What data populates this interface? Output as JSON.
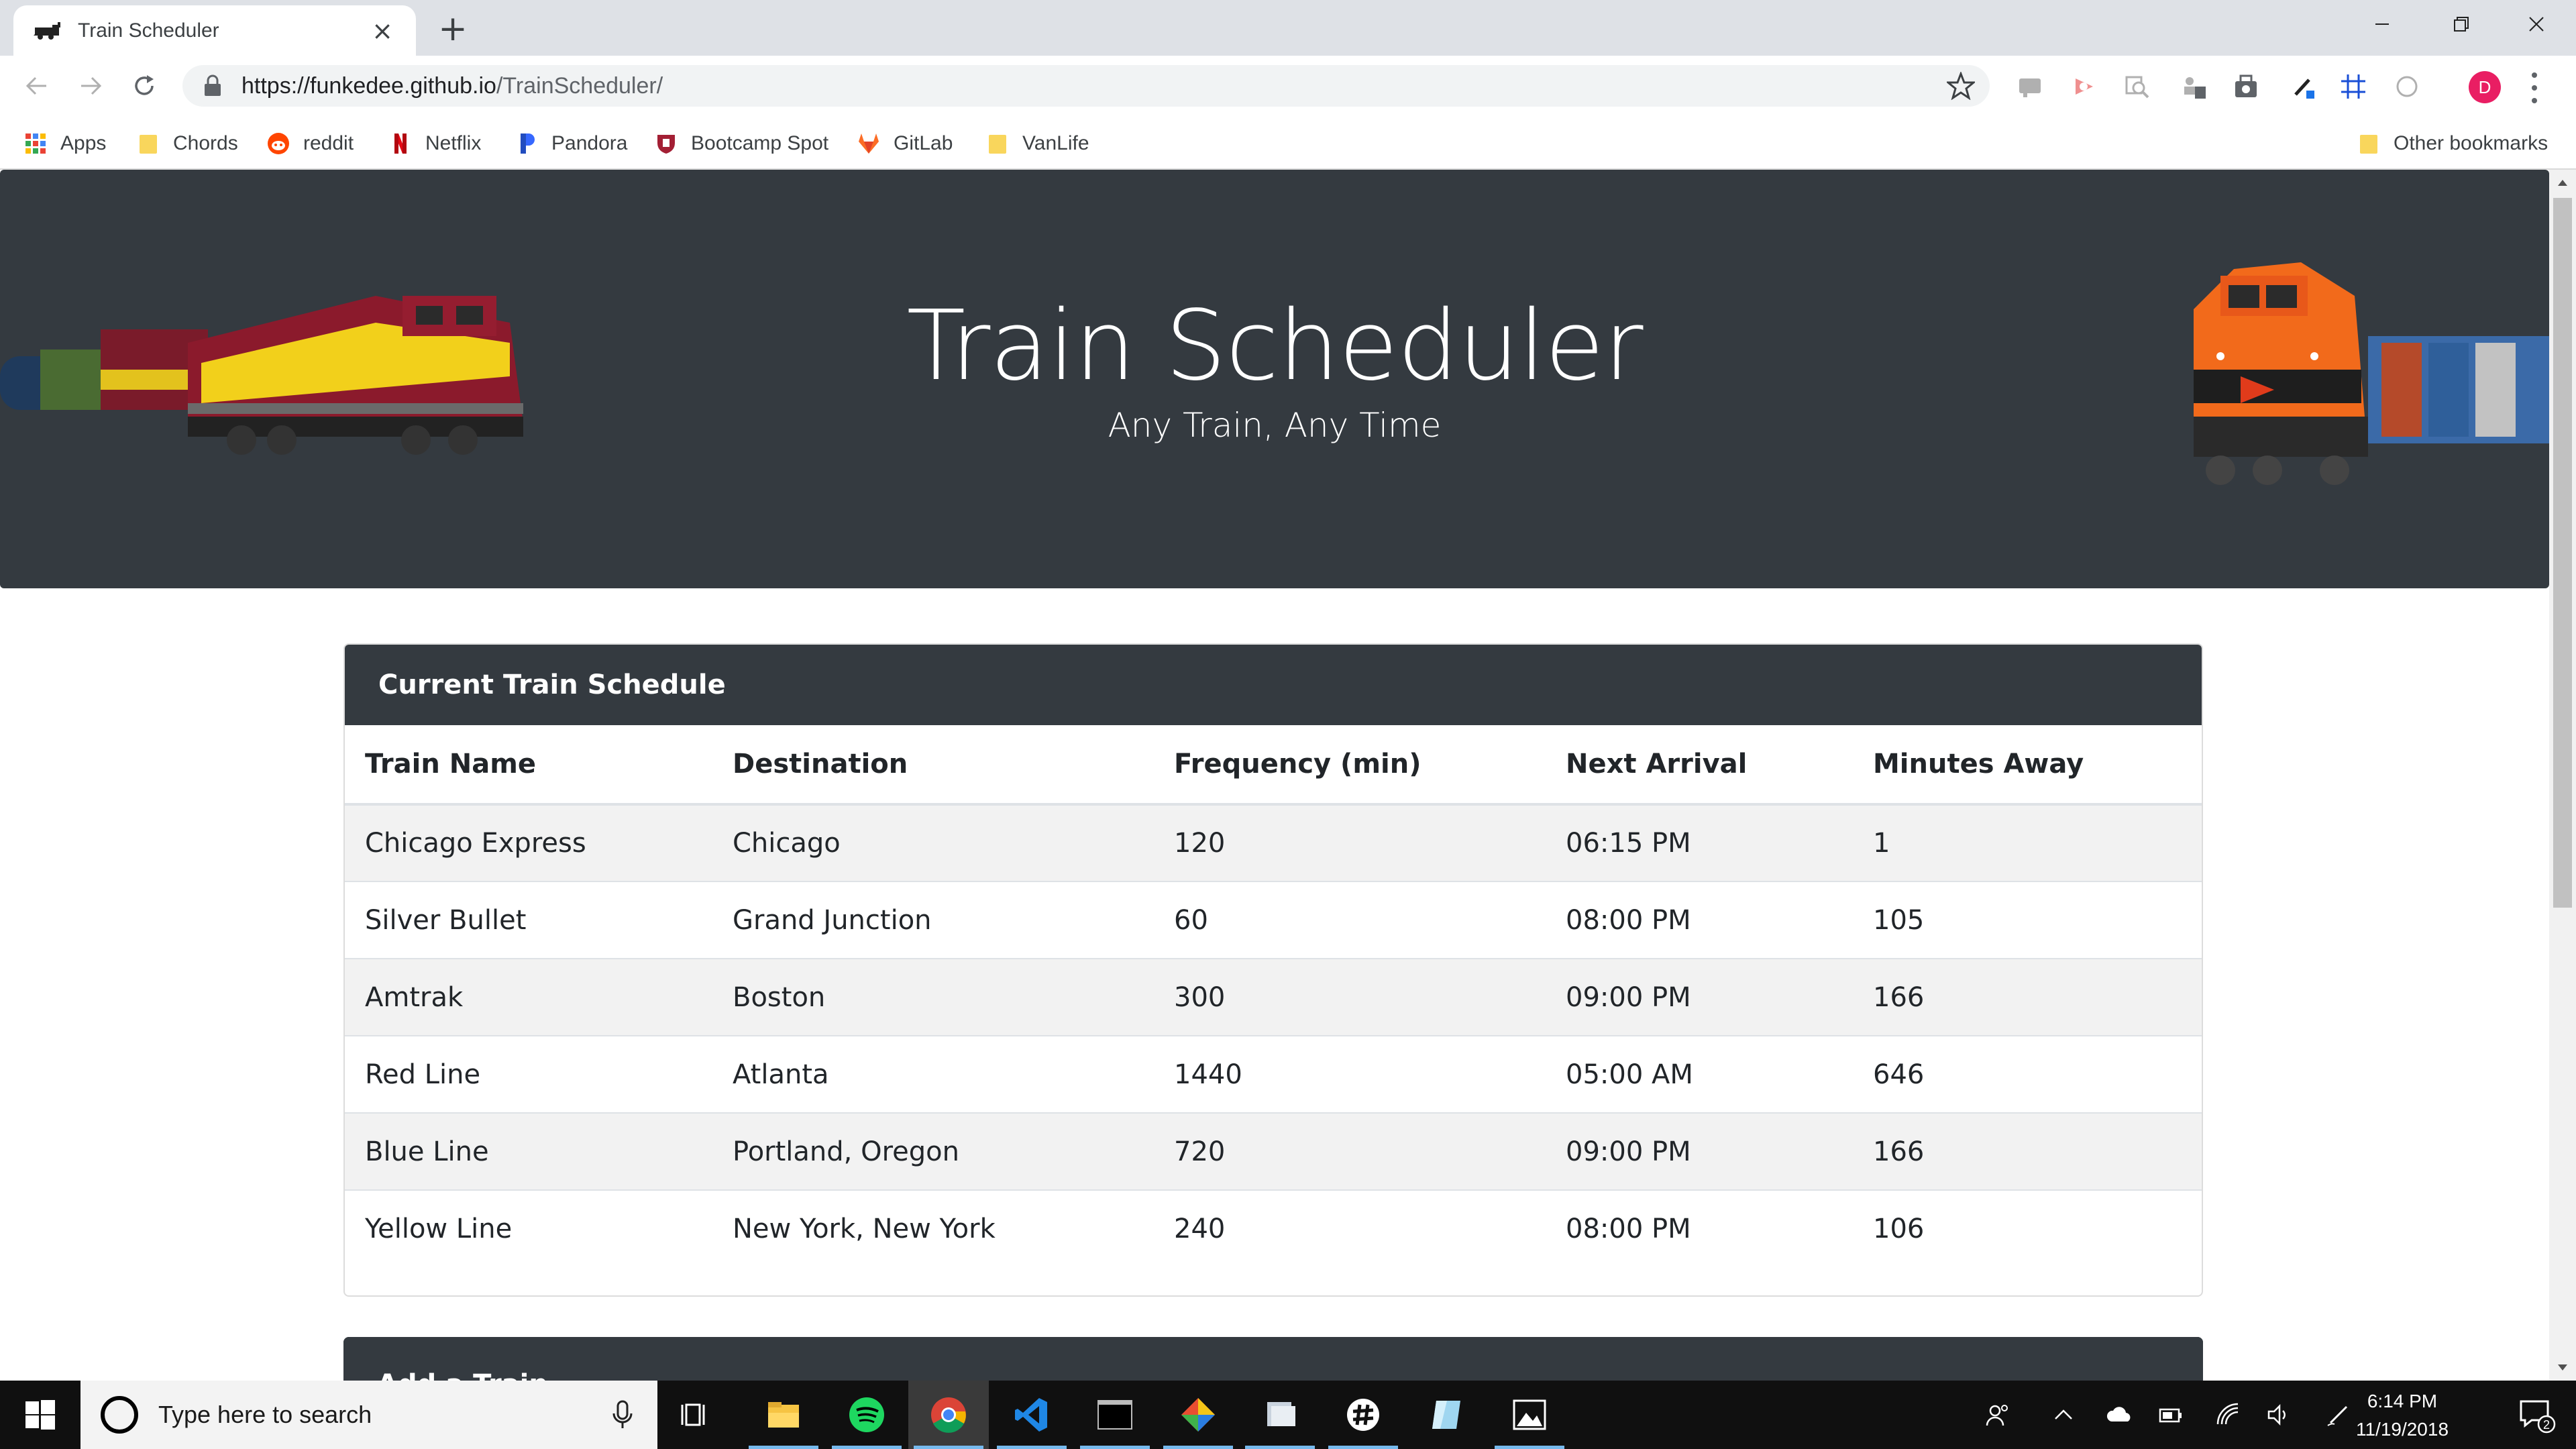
{
  "browser": {
    "tab_title": "Train Scheduler",
    "url_host": "https://funkedee.github.io",
    "url_path": "/TrainScheduler/",
    "profile_initial": "D",
    "bookmarks": [
      "Apps",
      "Chords",
      "reddit",
      "Netflix",
      "Pandora",
      "Bootcamp Spot",
      "GitLab",
      "VanLife"
    ],
    "other_bookmarks": "Other bookmarks"
  },
  "hero": {
    "title": "Train Scheduler",
    "subtitle": "Any Train, Any Time"
  },
  "schedule": {
    "header": "Current Train Schedule",
    "columns": [
      "Train Name",
      "Destination",
      "Frequency (min)",
      "Next Arrival",
      "Minutes Away"
    ],
    "rows": [
      [
        "Chicago Express",
        "Chicago",
        "120",
        "06:15 PM",
        "1"
      ],
      [
        "Silver Bullet",
        "Grand Junction",
        "60",
        "08:00 PM",
        "105"
      ],
      [
        "Amtrak",
        "Boston",
        "300",
        "09:00 PM",
        "166"
      ],
      [
        "Red Line",
        "Atlanta",
        "1440",
        "05:00 AM",
        "646"
      ],
      [
        "Blue Line",
        "Portland, Oregon",
        "720",
        "09:00 PM",
        "166"
      ],
      [
        "Yellow Line",
        "New York, New York",
        "240",
        "08:00 PM",
        "106"
      ]
    ]
  },
  "add_train": {
    "header": "Add a Train"
  },
  "taskbar": {
    "search_placeholder": "Type here to search",
    "time": "6:14 PM",
    "date": "11/19/2018",
    "notification_count": "2"
  },
  "colors": {
    "jumbotron": "#343a40",
    "card_header": "#343a40",
    "tabstrip": "#dee1e6",
    "profile": "#e91e63"
  }
}
